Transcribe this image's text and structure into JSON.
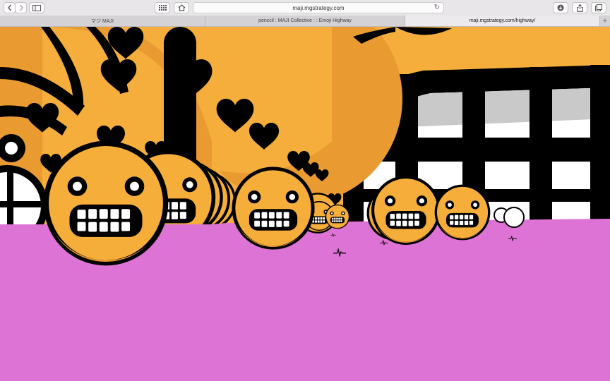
{
  "browser": {
    "address": "maji.mgstrategy.com",
    "tabs": [
      {
        "label": "マジ MAJI"
      },
      {
        "label": "penccil : MAJI Collective : : Emoji Highway"
      },
      {
        "label": "maji.mgstrategy.com/highway/"
      }
    ],
    "new_tab_label": "+"
  },
  "colors": {
    "chrome": "#e8e6e8",
    "sky": "#f5ae3c",
    "ground": "#dd73d5",
    "emoji": "#f6ae3a",
    "emoji_shade": "#e8982e",
    "outline": "#000000",
    "window_light": "#ffffff",
    "window_gray": "#c9c9c9"
  },
  "icons": [
    "chevron-left-icon",
    "chevron-right-icon",
    "sidebar-icon",
    "grid-icon",
    "home-icon",
    "reload-icon",
    "download-icon",
    "share-icon",
    "tabs-icon"
  ]
}
